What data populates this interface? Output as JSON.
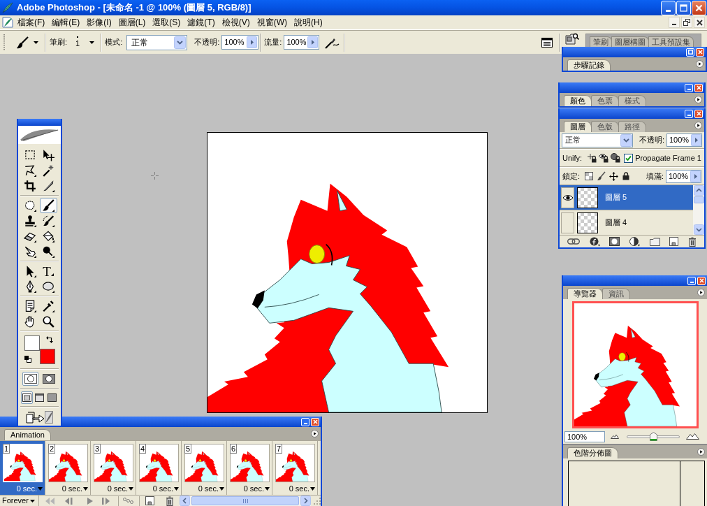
{
  "window": {
    "title": "Adobe Photoshop - [未命名 -1 @ 100% (圖層 5, RGB/8)]"
  },
  "menu": [
    "檔案(F)",
    "編輯(E)",
    "影像(I)",
    "圖層(L)",
    "選取(S)",
    "濾鏡(T)",
    "檢視(V)",
    "視窗(W)",
    "說明(H)"
  ],
  "options_bar": {
    "brush_label": "筆刷:",
    "brush_size": "1",
    "mode_label": "模式:",
    "mode": "正常",
    "opacity_label": "不透明:",
    "opacity": "100%",
    "flow_label": "流量:",
    "flow": "100%"
  },
  "palette_well": {
    "tabs": [
      {
        "label": "筆刷",
        "selected": false
      },
      {
        "label": "圖層構圖",
        "selected": false
      },
      {
        "label": "工具預設集",
        "selected": false
      }
    ]
  },
  "toolbox": {
    "tool_groups": [
      {
        "tools": [
          {
            "kind": "marquee",
            "selected": false
          },
          {
            "kind": "move",
            "selected": false
          },
          {
            "kind": "lasso",
            "selected": false
          },
          {
            "kind": "magic_wand",
            "selected": false
          },
          {
            "kind": "crop",
            "selected": false
          },
          {
            "kind": "slice",
            "selected": false
          }
        ]
      },
      {
        "tools": [
          {
            "kind": "patch",
            "selected": false
          },
          {
            "kind": "brush",
            "selected": true
          },
          {
            "kind": "stamp",
            "selected": false
          },
          {
            "kind": "history_brush",
            "selected": false
          },
          {
            "kind": "eraser",
            "selected": false
          },
          {
            "kind": "bucket",
            "selected": false
          },
          {
            "kind": "smudge",
            "selected": false
          },
          {
            "kind": "dodge",
            "selected": false
          }
        ]
      },
      {
        "tools": [
          {
            "kind": "path_select",
            "selected": false
          },
          {
            "kind": "type",
            "glyph": "T",
            "selected": false
          },
          {
            "kind": "pen",
            "selected": false
          },
          {
            "kind": "shape",
            "selected": false
          }
        ]
      },
      {
        "tools": [
          {
            "kind": "notes",
            "selected": false
          },
          {
            "kind": "eyedropper",
            "selected": false
          },
          {
            "kind": "hand",
            "selected": false
          },
          {
            "kind": "zoom",
            "selected": false
          }
        ]
      }
    ],
    "colors": [
      {
        "kind": "foreground",
        "color": "#ffffff"
      },
      {
        "kind": "background",
        "color": "#ff0000"
      }
    ],
    "mask_modes": [
      {
        "kind": "standard",
        "selected": true
      },
      {
        "kind": "quick_mask",
        "selected": false
      }
    ],
    "screen_modes": [
      {
        "kind": "standard",
        "selected": true
      },
      {
        "kind": "full_with_menu",
        "selected": false
      },
      {
        "kind": "full",
        "selected": false
      }
    ]
  },
  "history_panel": {
    "tabs": [
      {
        "label": "步驟記錄",
        "selected": true
      }
    ]
  },
  "color_panel": {
    "tabs": [
      {
        "label": "顏色",
        "selected": true
      },
      {
        "label": "色票",
        "selected": false
      },
      {
        "label": "樣式",
        "selected": false
      }
    ]
  },
  "layers_panel": {
    "tabs": [
      {
        "label": "圖層",
        "selected": true
      },
      {
        "label": "色版",
        "selected": false
      },
      {
        "label": "路徑",
        "selected": false
      }
    ],
    "blend_mode": "正常",
    "opacity_label": "不透明:",
    "opacity": "100%",
    "unify_label": "Unify:",
    "propagate": {
      "label": "Propagate Frame 1",
      "checked": true
    },
    "lock_label": "鎖定:",
    "fill_label": "填滿:",
    "fill": "100%",
    "layers": [
      {
        "name": "圖層 5",
        "visible": true,
        "selected": true
      },
      {
        "name": "圖層 4",
        "visible": false,
        "selected": false
      }
    ]
  },
  "navigator_panel": {
    "tabs": [
      {
        "label": "導覽器",
        "selected": true
      },
      {
        "label": "資訊",
        "selected": false
      }
    ],
    "zoom": "100%",
    "zoom_slider": {
      "level": 0.5
    }
  },
  "histogram_panel": {
    "tabs": [
      {
        "label": "色階分佈圖",
        "selected": true
      }
    ]
  },
  "animation_panel": {
    "tabs": [
      {
        "label": "Animation",
        "selected": true
      }
    ],
    "frames": [
      {
        "number": "1",
        "delay": "0 sec.",
        "selected": true
      },
      {
        "number": "2",
        "delay": "0 sec.",
        "selected": false
      },
      {
        "number": "3",
        "delay": "0 sec.",
        "selected": false
      },
      {
        "number": "4",
        "delay": "0 sec.",
        "selected": false
      },
      {
        "number": "5",
        "delay": "0 sec.",
        "selected": false
      },
      {
        "number": "6",
        "delay": "0 sec.",
        "selected": false
      },
      {
        "number": "7",
        "delay": "0 sec.",
        "selected": false
      }
    ],
    "loop": "Forever"
  }
}
